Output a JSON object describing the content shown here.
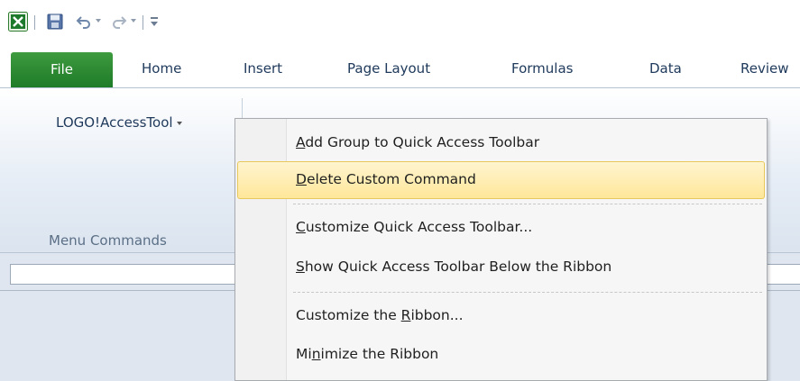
{
  "tabs": {
    "file": "File",
    "home": "Home",
    "insert": "Insert",
    "page_layout": "Page Layout",
    "formulas": "Formulas",
    "data": "Data",
    "review": "Review"
  },
  "ribbon": {
    "button_label": "LOGO!AccessTool",
    "group_label": "Menu Commands"
  },
  "context_menu": {
    "items": [
      {
        "pre": "",
        "key": "A",
        "post": "dd Group to Quick Access Toolbar"
      },
      {
        "pre": "",
        "key": "D",
        "post": "elete Custom Command"
      },
      {
        "pre": "",
        "key": "C",
        "post": "ustomize Quick Access Toolbar..."
      },
      {
        "pre": "",
        "key": "S",
        "post": "how Quick Access Toolbar Below the Ribbon"
      },
      {
        "pre": "Customize the ",
        "key": "R",
        "post": "ibbon..."
      },
      {
        "pre": "Mi",
        "key": "n",
        "post": "imize the Ribbon"
      }
    ]
  },
  "colors": {
    "file_tab": "#1e7b28",
    "hover_border": "#e9c85b",
    "hover_fill": "#ffe79a"
  },
  "icons": [
    "excel-icon",
    "save-icon",
    "undo-icon",
    "redo-icon",
    "customize-qat-icon"
  ]
}
